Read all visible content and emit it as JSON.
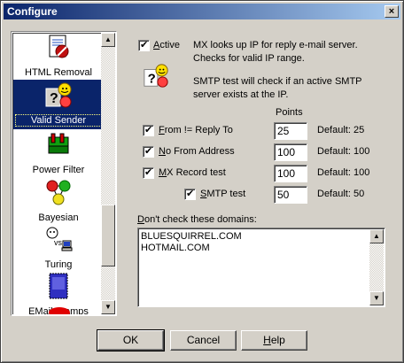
{
  "window": {
    "title": "Configure",
    "close_glyph": "×"
  },
  "sidebar": {
    "items": [
      {
        "label": "HTML Removal",
        "icon": "html-removal-icon"
      },
      {
        "label": "Valid Sender",
        "icon": "valid-sender-icon",
        "selected": true
      },
      {
        "label": "Power Filter",
        "icon": "power-filter-icon"
      },
      {
        "label": "Bayesian",
        "icon": "bayesian-icon"
      },
      {
        "label": "Turing",
        "icon": "turing-icon"
      },
      {
        "label": "EMail Stamps",
        "icon": "email-stamps-icon"
      }
    ]
  },
  "active": {
    "label_prefix": "",
    "label_access": "A",
    "label_rest": "ctive",
    "checked": true,
    "desc1_line1": "MX looks up IP for reply e-mail server.",
    "desc1_line2": "Checks for valid IP range.",
    "desc2_line1": "SMTP test will check if an active SMTP",
    "desc2_line2": "server exists at the IP."
  },
  "points_header": "Points",
  "rules": [
    {
      "access": "F",
      "rest": "rom != Reply To",
      "value": "25",
      "default": "Default: 25",
      "checked": true
    },
    {
      "access": "N",
      "rest": "o From Address",
      "value": "100",
      "default": "Default: 100",
      "checked": true
    },
    {
      "access": "M",
      "rest": "X Record test",
      "value": "100",
      "default": "Default: 100",
      "checked": true
    },
    {
      "access": "S",
      "rest": "MTP test",
      "value": "50",
      "default": "Default: 50",
      "checked": true
    }
  ],
  "domains": {
    "label_access": "D",
    "label_rest": "on't check these domains:",
    "lines": [
      "BLUESQUIRREL.COM",
      "HOTMAIL.COM"
    ]
  },
  "buttons": {
    "ok": "OK",
    "cancel": "Cancel",
    "help_access": "H",
    "help_rest": "elp"
  }
}
